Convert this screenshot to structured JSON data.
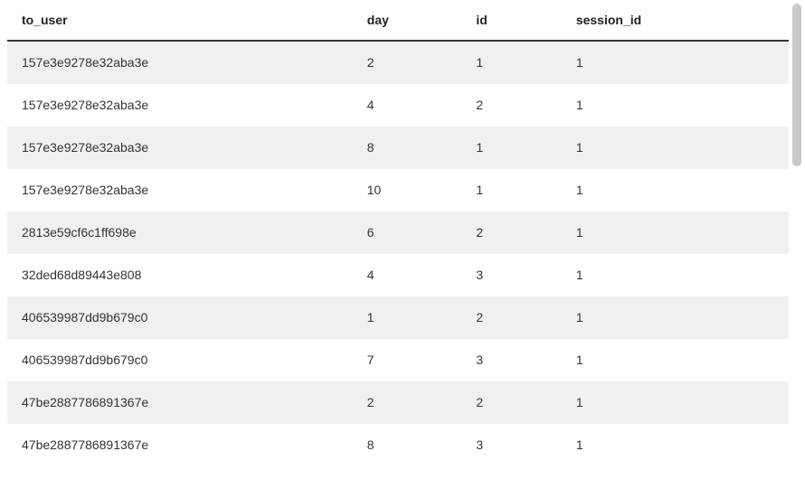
{
  "table": {
    "columns": [
      {
        "key": "to_user",
        "label": "to_user"
      },
      {
        "key": "day",
        "label": "day"
      },
      {
        "key": "id",
        "label": "id"
      },
      {
        "key": "session_id",
        "label": "session_id"
      }
    ],
    "rows": [
      {
        "to_user": "157e3e9278e32aba3e",
        "day": "2",
        "id": "1",
        "session_id": "1"
      },
      {
        "to_user": "157e3e9278e32aba3e",
        "day": "4",
        "id": "2",
        "session_id": "1"
      },
      {
        "to_user": "157e3e9278e32aba3e",
        "day": "8",
        "id": "1",
        "session_id": "1"
      },
      {
        "to_user": "157e3e9278e32aba3e",
        "day": "10",
        "id": "1",
        "session_id": "1"
      },
      {
        "to_user": "2813e59cf6c1ff698e",
        "day": "6",
        "id": "2",
        "session_id": "1"
      },
      {
        "to_user": "32ded68d89443e808",
        "day": "4",
        "id": "3",
        "session_id": "1"
      },
      {
        "to_user": "406539987dd9b679c0",
        "day": "1",
        "id": "2",
        "session_id": "1"
      },
      {
        "to_user": "406539987dd9b679c0",
        "day": "7",
        "id": "3",
        "session_id": "1"
      },
      {
        "to_user": "47be2887786891367e",
        "day": "2",
        "id": "2",
        "session_id": "1"
      },
      {
        "to_user": "47be2887786891367e",
        "day": "8",
        "id": "3",
        "session_id": "1"
      }
    ]
  }
}
